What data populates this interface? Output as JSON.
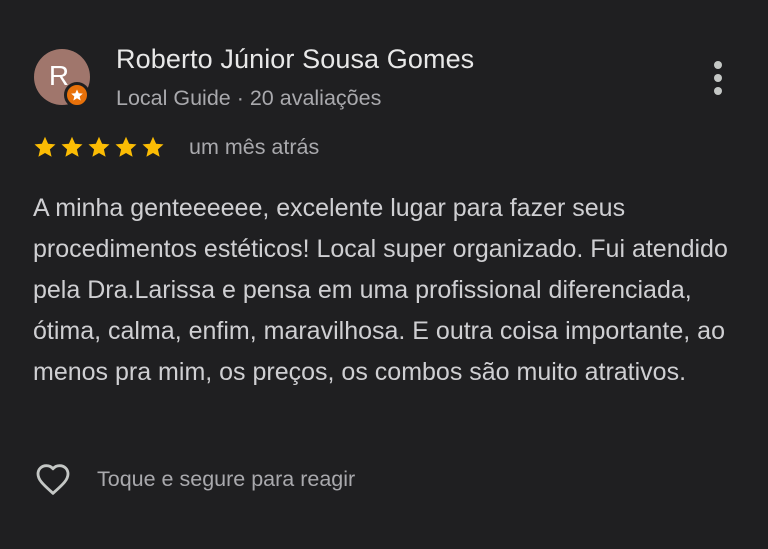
{
  "review": {
    "author": {
      "avatar_initial": "R",
      "name": "Roberto Júnior Sousa Gomes",
      "meta": "Local Guide · 20 avaliações",
      "avatar_color": "#a0766c",
      "badge_color": "#e8710a",
      "badge_icon": "star-icon"
    },
    "rating": 5,
    "max_rating": 5,
    "star_color": "#fbbc04",
    "date": "um mês atrás",
    "text": "A minha genteeeeee, excelente lugar para fazer seus procedimentos estéticos! Local super organizado. Fui atendido pela Dra.Larissa e pensa em uma profissional diferenciada, ótima, calma, enfim, maravilhosa. E outra coisa importante, ao menos pra mim, os preços, os combos são muito atrativos.",
    "more_icon": "more-vert-icon",
    "react": {
      "icon": "heart-outline-icon",
      "label": "Toque e segure para reagir"
    }
  }
}
